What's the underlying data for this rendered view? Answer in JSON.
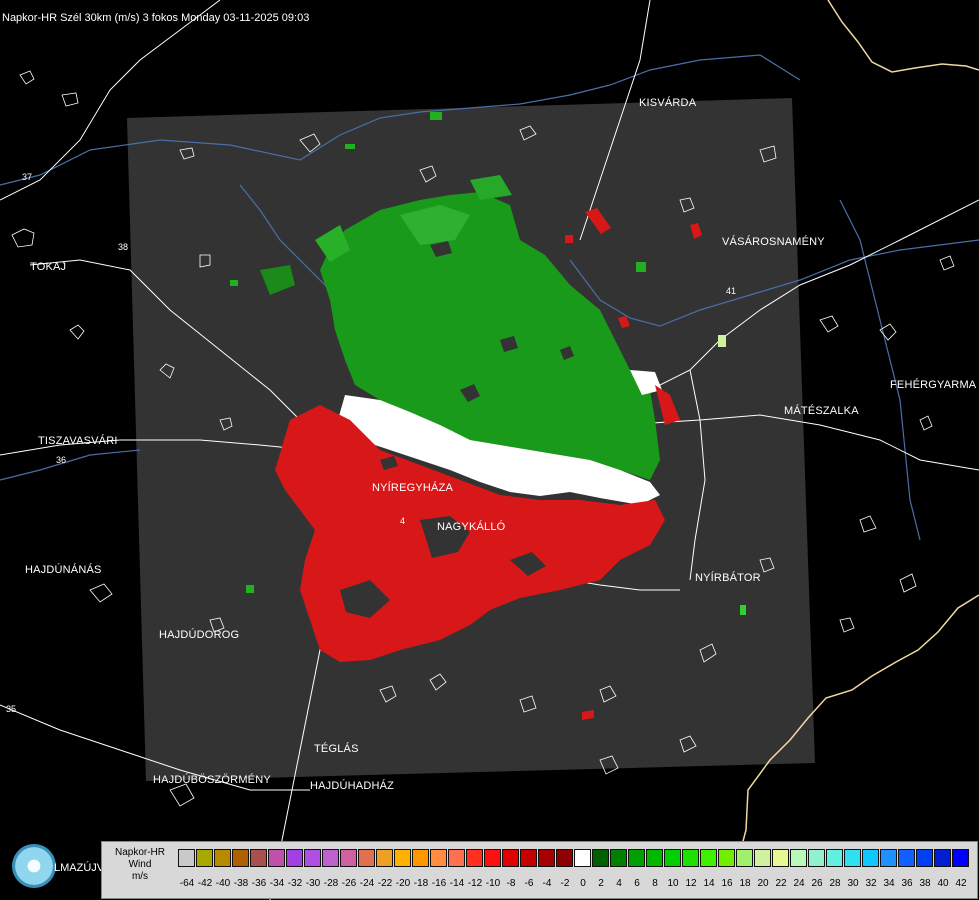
{
  "header": {
    "title": "Napkor-HR Szél 30km (m/s) 3 fokos Monday 03-11-2025 09:03"
  },
  "map": {
    "cities": [
      {
        "id": "kisvarda",
        "name": "KISVÁRDA"
      },
      {
        "id": "tokaj",
        "name": "TOKAJ"
      },
      {
        "id": "vasarosnameny",
        "name": "VÁSÁROSNAMÉNY"
      },
      {
        "id": "fehergyarmat",
        "name": "FEHÉRGYARMA"
      },
      {
        "id": "mateszalka",
        "name": "MÁTÉSZALKA"
      },
      {
        "id": "tiszavasvari",
        "name": "TISZAVASVÁRI"
      },
      {
        "id": "nyiregyhaza",
        "name": "NYÍREGYHÁZA"
      },
      {
        "id": "nagykallo",
        "name": "NAGYKÁLLÓ"
      },
      {
        "id": "hajdunanas",
        "name": "HAJDÚNÁNÁS"
      },
      {
        "id": "nyirbator",
        "name": "NYÍRBÁTOR"
      },
      {
        "id": "hajdudorog",
        "name": "HAJDÚDOROG"
      },
      {
        "id": "teglas",
        "name": "TÉGLÁS"
      },
      {
        "id": "hajduboszormeny",
        "name": "HAJDÚBÖSZÖRMÉNY"
      },
      {
        "id": "hajduhadhaz",
        "name": "HAJDÚHADHÁZ"
      }
    ],
    "road_numbers": [
      "37",
      "38",
      "36",
      "4",
      "41",
      "35"
    ]
  },
  "logo": {
    "text": "LMAZÚJVÁR"
  },
  "legend": {
    "label_lines": [
      "Napkor-HR",
      "Wind",
      "m/s"
    ],
    "values": [
      "-64",
      "-42",
      "-40",
      "-38",
      "-36",
      "-34",
      "-32",
      "-30",
      "-28",
      "-26",
      "-24",
      "-22",
      "-20",
      "-18",
      "-16",
      "-14",
      "-12",
      "-10",
      "-8",
      "-6",
      "-4",
      "-2",
      "0",
      "2",
      "4",
      "6",
      "8",
      "10",
      "12",
      "14",
      "16",
      "18",
      "20",
      "22",
      "24",
      "26",
      "28",
      "30",
      "32",
      "34",
      "36",
      "38",
      "40",
      "42"
    ],
    "colors": [
      "#c9c9c9",
      "#a8a800",
      "#b88a00",
      "#b06000",
      "#a84f4f",
      "#c050a8",
      "#a040e0",
      "#b050e0",
      "#c060d0",
      "#d060a0",
      "#e07050",
      "#f0a020",
      "#ffb000",
      "#ff9800",
      "#ff8c40",
      "#ff7050",
      "#ff3020",
      "#ff1010",
      "#e00000",
      "#c40000",
      "#a80000",
      "#900000",
      "#ffffff",
      "#006000",
      "#008000",
      "#00a000",
      "#00b800",
      "#00d000",
      "#20e000",
      "#40f000",
      "#70f000",
      "#a0f070",
      "#d0f0a0",
      "#e8f890",
      "#b8f8b8",
      "#90f0d0",
      "#60f0e0",
      "#30e0f0",
      "#10c8ff",
      "#2090ff",
      "#1060ff",
      "#0040f0",
      "#0020d0",
      "#0000ff"
    ]
  },
  "colors": {
    "radar_area": "#333333",
    "background": "#000000",
    "approaching": "#d81818",
    "receding": "#1a9a1a",
    "river": "#4a6fa8",
    "border": "#f0d8a0"
  }
}
